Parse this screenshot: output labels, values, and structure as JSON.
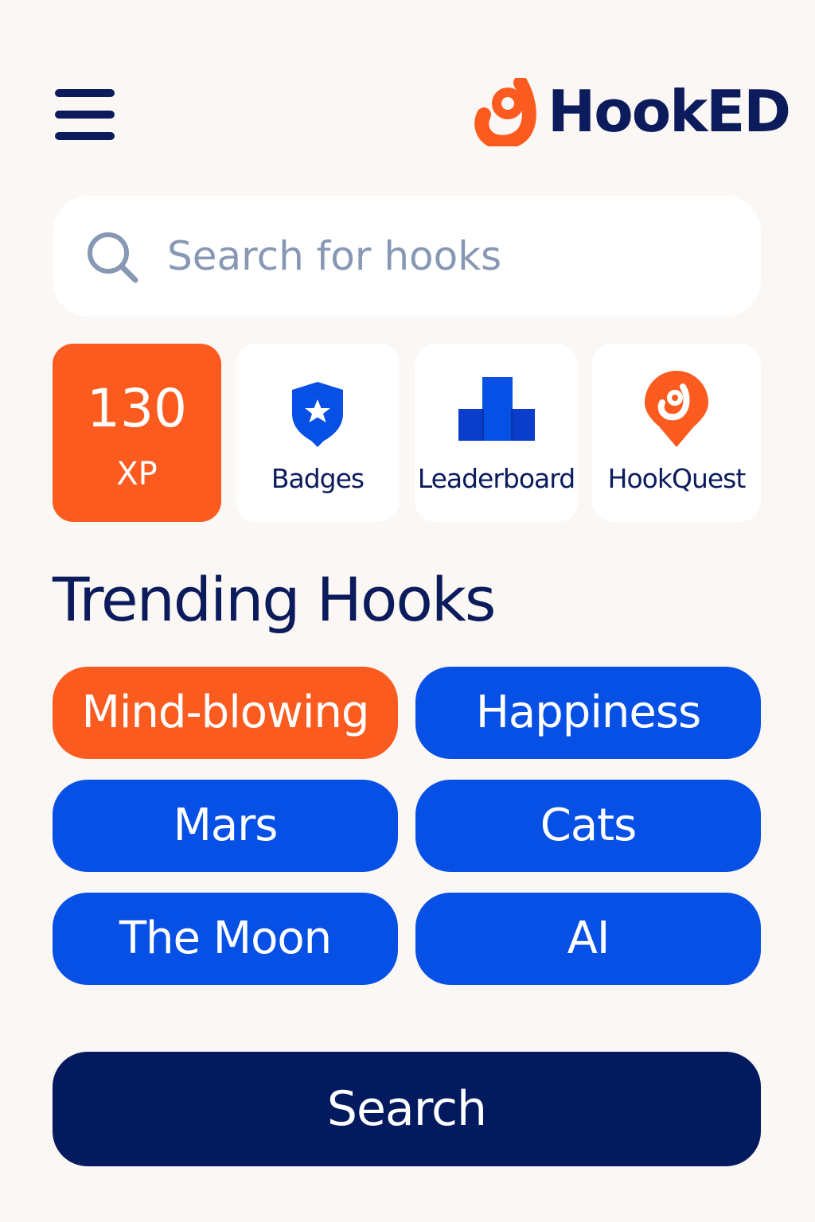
{
  "app": {
    "name": "HookED"
  },
  "header": {
    "menu_icon": "hamburger-menu-icon",
    "logo_icon": "hook-logo-icon"
  },
  "search": {
    "placeholder": "Search for hooks",
    "value": "",
    "icon": "search-icon"
  },
  "tiles": {
    "xp": {
      "value": "130",
      "unit": "XP"
    },
    "badges": {
      "label": "Badges",
      "icon": "badge-shield-star-icon"
    },
    "leaderboard": {
      "label": "Leaderboard",
      "icon": "leaderboard-podium-icon"
    },
    "hookquest": {
      "label": "HookQuest",
      "icon": "hook-pin-icon"
    }
  },
  "trending": {
    "title": "Trending Hooks",
    "hooks": [
      "Mind-blowing",
      "Happiness",
      "Mars",
      "Cats",
      "The Moon",
      "AI"
    ]
  },
  "actions": {
    "search_label": "Search"
  },
  "colors": {
    "background": "#FBF7F4",
    "navy": "#0B1B5C",
    "orange": "#FC5B1F",
    "blue": "#0750E6",
    "button_navy": "#041A5E",
    "placeholder": "#8798B4"
  }
}
